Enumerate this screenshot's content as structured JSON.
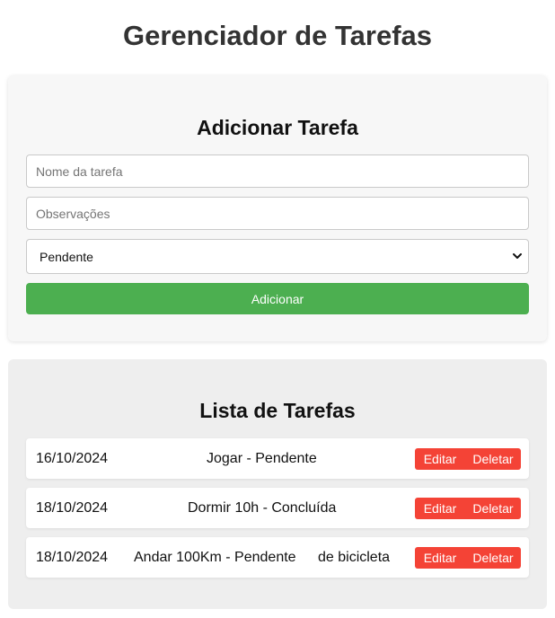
{
  "header": {
    "title": "Gerenciador de Tarefas"
  },
  "add_section": {
    "title": "Adicionar Tarefa",
    "name_placeholder": "Nome da tarefa",
    "notes_placeholder": "Observações",
    "status_selected": "Pendente",
    "add_label": "Adicionar"
  },
  "list_section": {
    "title": "Lista de Tarefas",
    "tasks": [
      {
        "date": "16/10/2024",
        "text": "Jogar - Pendente",
        "notes": "",
        "edit_label": "Editar",
        "delete_label": "Deletar"
      },
      {
        "date": "18/10/2024",
        "text": "Dormir 10h - Concluída",
        "notes": "",
        "edit_label": "Editar",
        "delete_label": "Deletar"
      },
      {
        "date": "18/10/2024",
        "text": "Andar 100Km - Pendente",
        "notes": "de bicicleta",
        "edit_label": "Editar",
        "delete_label": "Deletar"
      }
    ]
  },
  "colors": {
    "add_button": "#4caf50",
    "action_buttons": "#f44336",
    "add_card_bg": "#f7f7f7",
    "list_card_bg": "#eeeeee"
  },
  "icons": {
    "select_arrow": "chevron-down-icon"
  }
}
